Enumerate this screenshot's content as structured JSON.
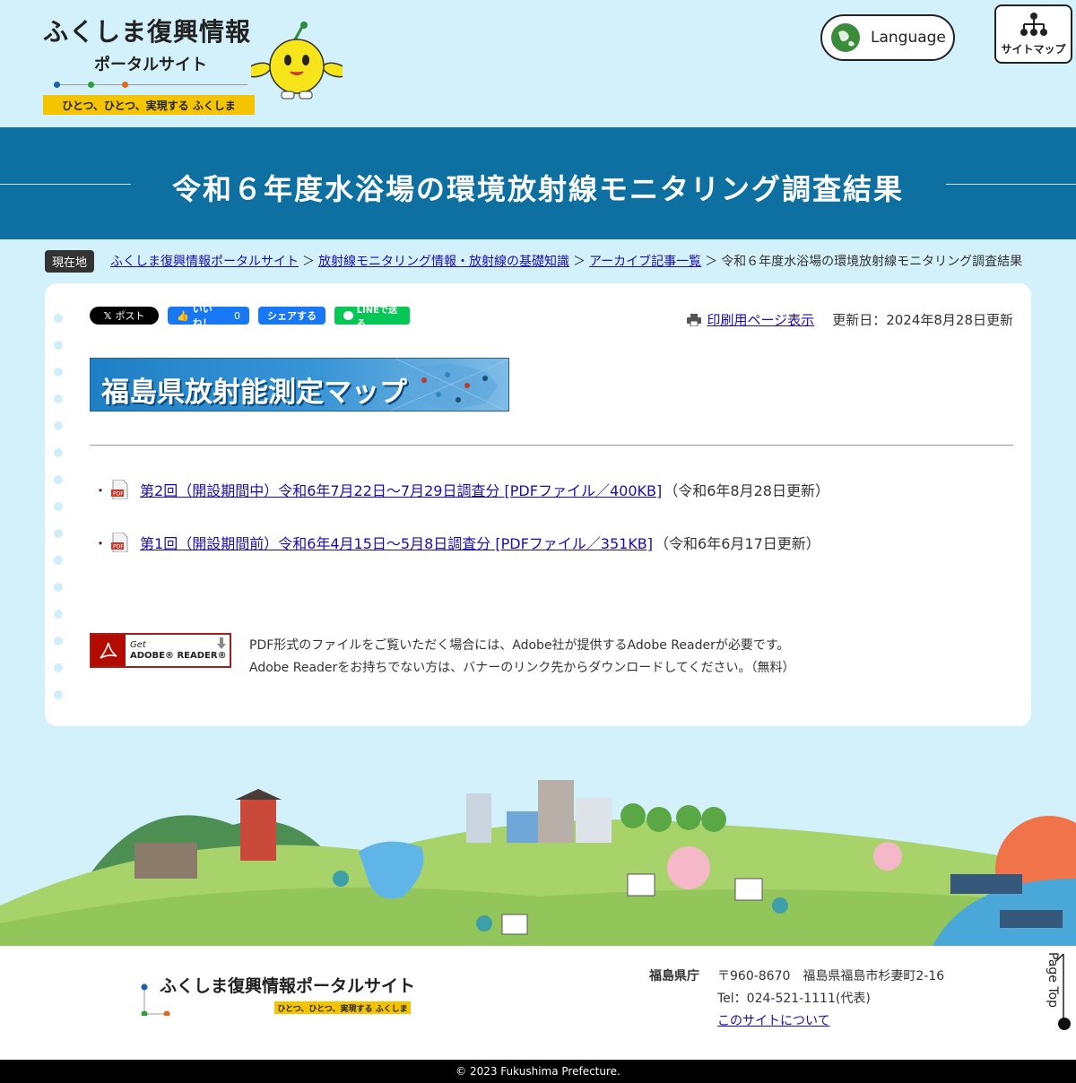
{
  "header": {
    "logo_main": "ふくしま復興情報",
    "logo_sub": "ポータルサイト",
    "logo_tagline": "ひとつ、ひとつ、実現する ふくしま",
    "language_label": "Language",
    "sitemap_label": "サイトマップ"
  },
  "page": {
    "title": "令和６年度水浴場の環境放射線モニタリング調査結果"
  },
  "breadcrumb": {
    "label": "現在地",
    "items": [
      "ふくしま復興情報ポータルサイト",
      "放射線モニタリング情報・放射線の基礎知識",
      "アーカイブ記事一覧"
    ],
    "separator": "＞",
    "current": "令和６年度水浴場の環境放射線モニタリング調査結果"
  },
  "social": {
    "x_label": "ポスト",
    "fb_like_label": "いいね！",
    "fb_like_count": "0",
    "share_label": "シェアする",
    "line_label": "LINEで送る"
  },
  "print": {
    "link_label": "印刷用ページ表示",
    "updated": "更新日：2024年8月28日更新"
  },
  "banner": {
    "text": "福島県放射能測定マップ"
  },
  "documents": [
    {
      "link": "第2回（開設期間中）令和6年7月22日～7月29日調査分 [PDFファイル／400KB]",
      "note": "（令和6年8月28日更新）"
    },
    {
      "link": "第1回（開設期間前）令和6年4月15日～5月8日調査分 [PDFファイル／351KB]",
      "note": "（令和6年6月17日更新）"
    }
  ],
  "adobe": {
    "get": "Get",
    "product": "ADOBE® READER®",
    "line1": "PDF形式のファイルをご覧いただく場合には、Adobe社が提供するAdobe Readerが必要です。",
    "line2": "Adobe Readerをお持ちでない方は、バナーのリンク先からダウンロードしてください。（無料）"
  },
  "footer": {
    "site_name": "ふくしま復興情報ポータルサイト",
    "tagline": "ひとつ、ひとつ、実現する ふくしま",
    "org": "福島県庁",
    "address": "〒960-8670　福島県福島市杉妻町2-16",
    "tel": "Tel：024-521-1111(代表)",
    "about_link": "このサイトについて",
    "page_top": "Page Top",
    "copyright": "© 2023 Fukushima Prefecture."
  },
  "colors": {
    "background": "#d3f1fb",
    "title_band": "#0e6fa1",
    "tagline_yellow": "#f5c400",
    "link": "#1a0dab"
  }
}
